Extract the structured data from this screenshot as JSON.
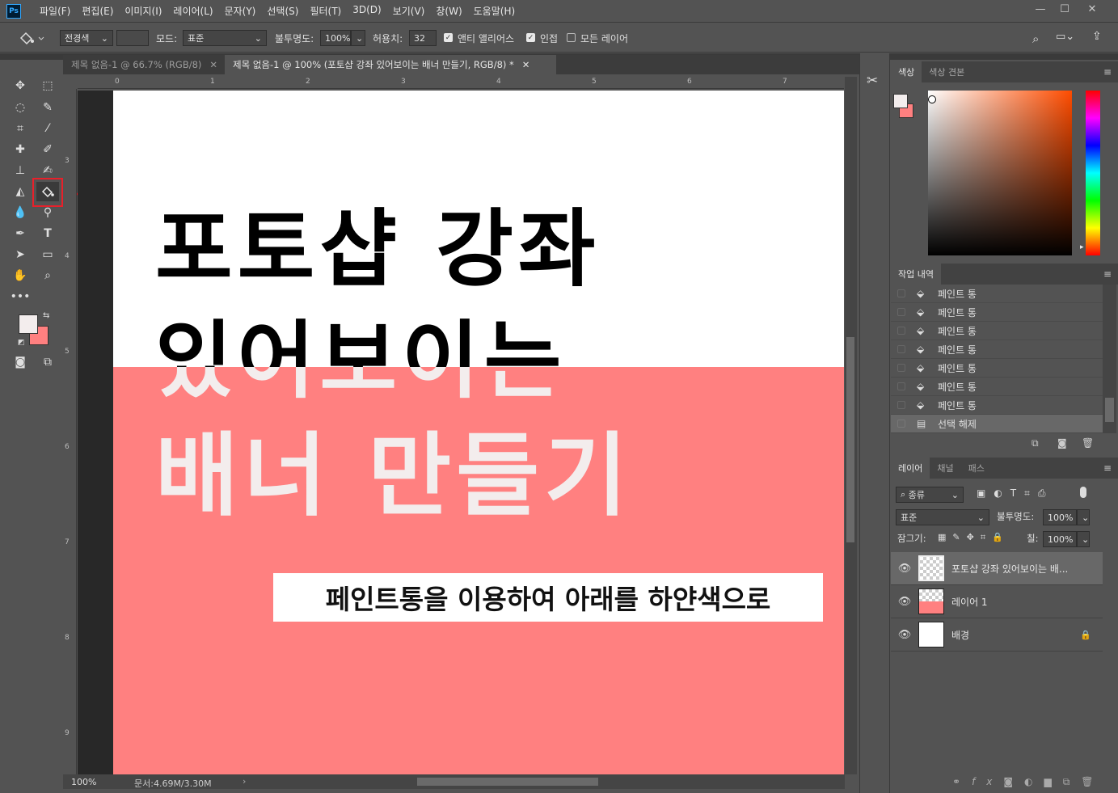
{
  "app": {
    "logo": "Ps"
  },
  "menu": [
    "파일(F)",
    "편집(E)",
    "이미지(I)",
    "레이어(L)",
    "문자(Y)",
    "선택(S)",
    "필터(T)",
    "3D(D)",
    "보기(V)",
    "창(W)",
    "도움말(H)"
  ],
  "options": {
    "fill_source": "전경색",
    "mode_label": "모드:",
    "mode_value": "표준",
    "opacity_label": "불투명도:",
    "opacity_value": "100%",
    "tolerance_label": "허용치:",
    "tolerance_value": "32",
    "antialias_label": "앤티 앨리어스",
    "contiguous_label": "인접",
    "all_layers_label": "모든 레이어"
  },
  "tabs": [
    {
      "label": "제목 없음-1 @ 66.7% (RGB/8)",
      "active": false
    },
    {
      "label": "제목 없음-1 @ 100% (포토샵 강좌 있어보이는  배너 만들기, RGB/8) *",
      "active": true
    }
  ],
  "ruler_top": [
    "0",
    "1",
    "2",
    "3",
    "4",
    "5",
    "6",
    "7"
  ],
  "ruler_left": [
    "3",
    "4",
    "5",
    "6",
    "7",
    "8",
    "9"
  ],
  "canvas": {
    "line1": "포토샵 강좌",
    "line2": "있어보이는",
    "line3": "배너 만들기",
    "caption": "페인트통을 이용하여 아래를 하얀색으로",
    "bg_color": "#ffffff",
    "pink_color": "#ff8080",
    "annotation_color": "#e8202a"
  },
  "status": {
    "zoom": "100%",
    "doc_size": "문서:4.69M/3.30M"
  },
  "colors": {
    "foreground": "#f3eded",
    "background": "#ff8080"
  },
  "color_panel": {
    "tabs": [
      "색상",
      "색상 견본"
    ]
  },
  "history_panel": {
    "title": "작업 내역",
    "items": [
      "페인트 통",
      "페인트 통",
      "페인트 통",
      "페인트 통",
      "페인트 통",
      "페인트 통",
      "페인트 통",
      "선택 해제"
    ]
  },
  "layers_panel": {
    "tabs": [
      "레이어",
      "채널",
      "패스"
    ],
    "filter_label": "종류",
    "blend_mode": "표준",
    "opacity_label": "불투명도:",
    "opacity_value": "100%",
    "lock_label": "잠그기:",
    "fill_label": "칠:",
    "fill_value": "100%",
    "layers": [
      {
        "name": "포토샵 강좌 있어보이는  배...",
        "selected": true
      },
      {
        "name": "레이어 1",
        "selected": false
      },
      {
        "name": "배경",
        "selected": false,
        "locked": true
      }
    ]
  }
}
